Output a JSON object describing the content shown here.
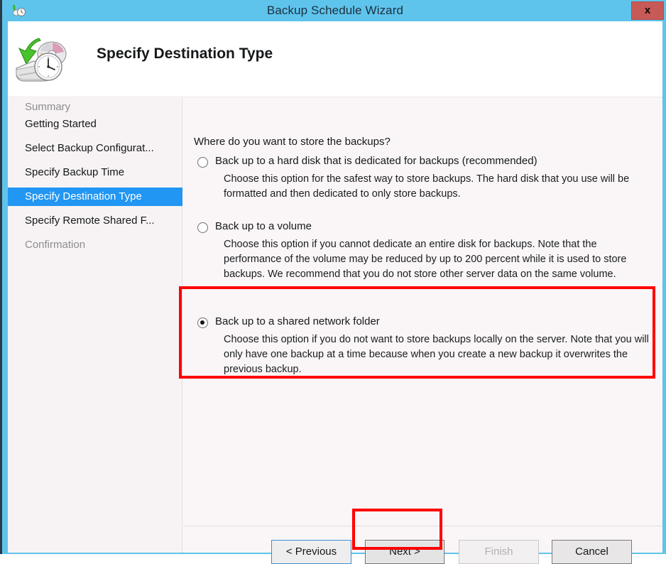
{
  "window": {
    "title": "Backup Schedule Wizard",
    "title_icon": "backup-clock-icon",
    "close_label": "x",
    "titlebar_color": "#5fc4ec",
    "close_button_color": "#c75a57"
  },
  "header": {
    "page_title": "Specify Destination Type",
    "icon": "disk-with-clock-and-green-arrow-icon"
  },
  "sidebar": {
    "items": [
      {
        "label": "Getting Started",
        "state": "normal"
      },
      {
        "label": "Select Backup Configurat...",
        "state": "normal"
      },
      {
        "label": "Specify Backup Time",
        "state": "normal"
      },
      {
        "label": "Specify Destination Type",
        "state": "current"
      },
      {
        "label": "Specify Remote Shared F...",
        "state": "normal"
      },
      {
        "label": "Confirmation",
        "state": "dim"
      },
      {
        "label": "Summary",
        "state": "dim"
      }
    ],
    "highlight_color": "#2196f3"
  },
  "main": {
    "question": "Where do you want to store the backups?",
    "options": [
      {
        "label": "Back up to a hard disk that is dedicated for backups (recommended)",
        "selected": false,
        "description": "Choose this option for the safest way to store backups. The hard disk that you use will be formatted and then dedicated to only store backups."
      },
      {
        "label": "Back up to a volume",
        "selected": false,
        "description": "Choose this option if you cannot dedicate an entire disk for backups. Note that the performance of the volume may be reduced by up to 200 percent while it is used to store backups. We recommend that you do not store other server data on the same volume."
      },
      {
        "label": "Back up to a shared network folder",
        "selected": true,
        "description": "Choose this option if you do not want to store backups locally on the server. Note that you will only have one backup at a time because when you create a new backup it overwrites the previous backup."
      }
    ]
  },
  "buttons": {
    "previous": "< Previous",
    "next": "Next >",
    "finish": "Finish",
    "cancel": "Cancel",
    "finish_disabled": true
  },
  "annotations": {
    "color": "#fe0000",
    "targets": [
      "option-3-shared-network-folder",
      "next-button"
    ]
  }
}
